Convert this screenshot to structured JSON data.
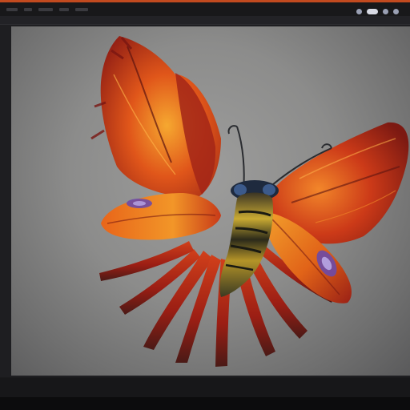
{
  "app": {
    "window_title": ""
  },
  "colors": {
    "accent_strip": "#c24a1f",
    "canvas_background": "#8e8e8d",
    "wing_red": "#b8271a",
    "wing_orange": "#e86a16",
    "wing_gold": "#f2a02a",
    "body_gold": "#b89a2a",
    "body_dark": "#2a2a1a",
    "eyespot_purple": "#6b4aa8"
  },
  "icons": {
    "tray": [
      "status-dot-icon",
      "toggle-icon",
      "user-icon",
      "network-icon"
    ]
  },
  "canvas": {
    "artwork_subject": ""
  },
  "statusbar": {
    "items": [
      "",
      "",
      ""
    ]
  }
}
